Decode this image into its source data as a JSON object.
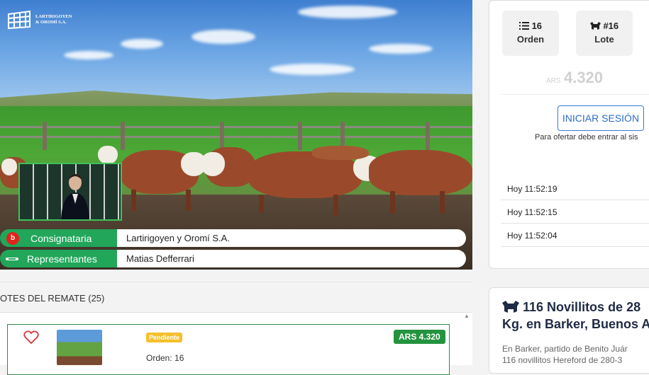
{
  "brand": {
    "line1": "LARTIRIGOYEN",
    "line2": "& OROMÍ S.A."
  },
  "video_info": {
    "consignataria_label": "Consignataria",
    "consignataria_value": "Lartirigoyen y Oromí S.A.",
    "representantes_label": "Representantes",
    "representantes_value": "Matias Defferrari",
    "badge_letter": "b"
  },
  "lots": {
    "title": "OTES DEL REMATE (25)",
    "items": [
      {
        "status": "Pendiente",
        "orden": "Orden: 16",
        "price": "ARS 4.320"
      }
    ]
  },
  "panel": {
    "orden_value": "16",
    "orden_label": "Orden",
    "lote_value": "#16",
    "lote_label": "Lote",
    "currency": "ARS",
    "price": "4.320",
    "login_label": "INICIAR SESIÓN",
    "login_note": "Para ofertar debe entrar al sis",
    "bids": [
      "Hoy 11:52:19",
      "Hoy 11:52:15",
      "Hoy 11:52:04"
    ]
  },
  "lot_detail": {
    "title_line1": "116 Novillitos de 28",
    "title_line2": "Kg. en Barker, Buenos A",
    "desc_line1": "En Barker, partido de Benito Juár",
    "desc_line2": "116 novillitos Hereford de 280-3"
  },
  "colors": {
    "green": "#21a65a",
    "price_green": "#23933f",
    "pending": "#f5c02e",
    "link_blue": "#2a6bc8"
  }
}
